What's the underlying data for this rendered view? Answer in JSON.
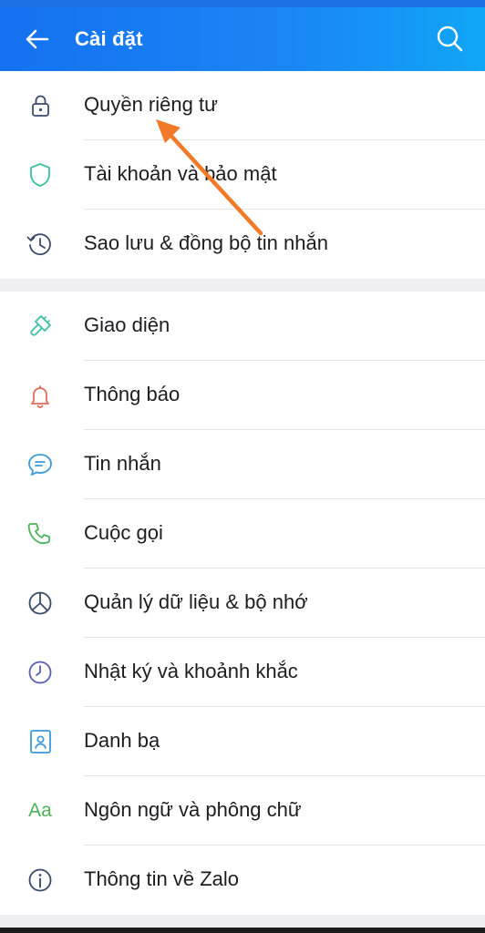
{
  "header": {
    "title": "Cài đặt",
    "back_icon": "arrow-left-icon",
    "search_icon": "search-icon"
  },
  "group1": [
    {
      "label": "Quyền riêng tư",
      "icon": "lock-icon"
    },
    {
      "label": "Tài khoản và bảo mật",
      "icon": "shield-icon"
    },
    {
      "label": "Sao lưu & đồng bộ tin nhắn",
      "icon": "backup-clock-icon"
    }
  ],
  "group2": [
    {
      "label": "Giao diện",
      "icon": "paint-brush-icon"
    },
    {
      "label": "Thông báo",
      "icon": "bell-icon"
    },
    {
      "label": "Tin nhắn",
      "icon": "chat-bubble-icon"
    },
    {
      "label": "Cuộc gọi",
      "icon": "phone-icon"
    },
    {
      "label": "Quản lý dữ liệu & bộ nhớ",
      "icon": "pie-chart-icon"
    },
    {
      "label": "Nhật ký và khoảnh khắc",
      "icon": "clock-icon"
    },
    {
      "label": "Danh bạ",
      "icon": "contacts-icon"
    },
    {
      "label": "Ngôn ngữ và phông chữ",
      "icon": "font-aa-icon",
      "icon_text": "Aa"
    },
    {
      "label": "Thông tin về Zalo",
      "icon": "info-icon"
    }
  ],
  "colors": {
    "header_start": "#1471f0",
    "header_end": "#10a6f7",
    "annotation_arrow": "#f07a28"
  }
}
